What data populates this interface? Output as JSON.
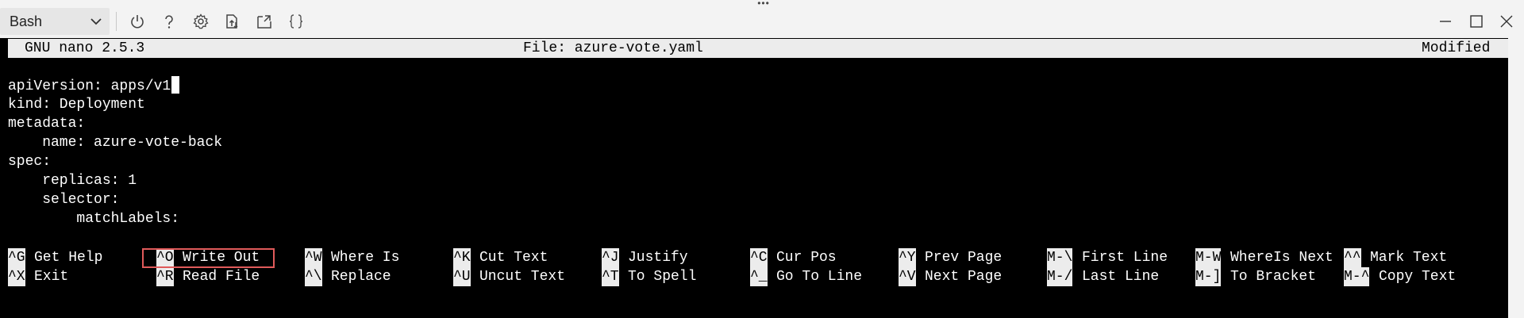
{
  "toolbar": {
    "shell_label": "Bash",
    "icons": [
      "chevron-down-icon",
      "power-icon",
      "help-icon",
      "settings-icon",
      "upload-download-icon",
      "open-editor-icon",
      "braces-icon"
    ],
    "window_icons": [
      "minimize-icon",
      "maximize-icon",
      "close-icon"
    ]
  },
  "nano": {
    "version": "GNU nano 2.5.3",
    "file": "File: azure-vote.yaml",
    "status": "Modified"
  },
  "editor": {
    "lines": [
      "apiVersion: apps/v1",
      "kind: Deployment",
      "metadata:",
      "    name: azure-vote-back",
      "spec:",
      "    replicas: 1",
      "    selector:",
      "        matchLabels:"
    ]
  },
  "shortcuts": {
    "row1": [
      {
        "key": "^G",
        "label": "Get Help"
      },
      {
        "key": "^O",
        "label": "Write Out"
      },
      {
        "key": "^W",
        "label": "Where Is"
      },
      {
        "key": "^K",
        "label": "Cut Text"
      },
      {
        "key": "^J",
        "label": "Justify"
      },
      {
        "key": "^C",
        "label": "Cur Pos"
      },
      {
        "key": "^Y",
        "label": "Prev Page"
      },
      {
        "key": "M-\\",
        "label": "First Line"
      },
      {
        "key": "M-W",
        "label": "WhereIs Next"
      },
      {
        "key": "^^",
        "label": "Mark Text"
      }
    ],
    "row2": [
      {
        "key": "^X",
        "label": "Exit"
      },
      {
        "key": "^R",
        "label": "Read File"
      },
      {
        "key": "^\\",
        "label": "Replace"
      },
      {
        "key": "^U",
        "label": "Uncut Text"
      },
      {
        "key": "^T",
        "label": "To Spell"
      },
      {
        "key": "^_",
        "label": "Go To Line"
      },
      {
        "key": "^V",
        "label": "Next Page"
      },
      {
        "key": "M-/",
        "label": "Last Line"
      },
      {
        "key": "M-]",
        "label": "To Bracket"
      },
      {
        "key": "M-^",
        "label": "Copy Text"
      }
    ]
  },
  "colors": {
    "terminal_bg": "#000000",
    "terminal_fg": "#ffffff",
    "bar_bg": "#ececec",
    "highlight": "#e05a5a",
    "toolbar_bg": "#f3f3f3"
  }
}
